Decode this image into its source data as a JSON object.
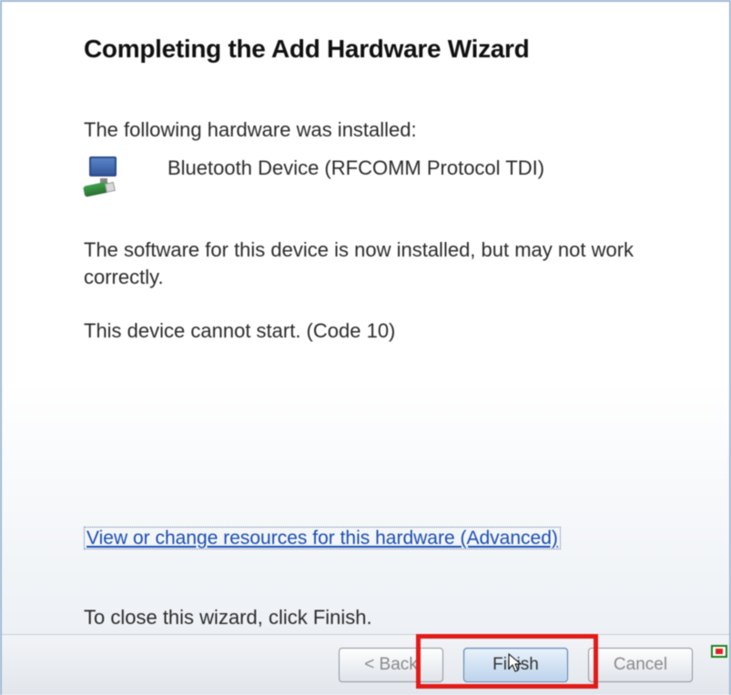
{
  "title": "Completing the Add Hardware Wizard",
  "lead": "The following hardware was installed:",
  "hardware_name": "Bluetooth Device (RFCOMM Protocol TDI)",
  "status1": "The software for this device is now installed, but may not work correctly.",
  "status2": "This device cannot start. (Code 10)",
  "advanced_link": "View or change resources for this hardware (Advanced)",
  "close_hint": "To close this wizard, click Finish.",
  "buttons": {
    "back": "< Back",
    "finish": "Finish",
    "cancel": "Cancel"
  }
}
